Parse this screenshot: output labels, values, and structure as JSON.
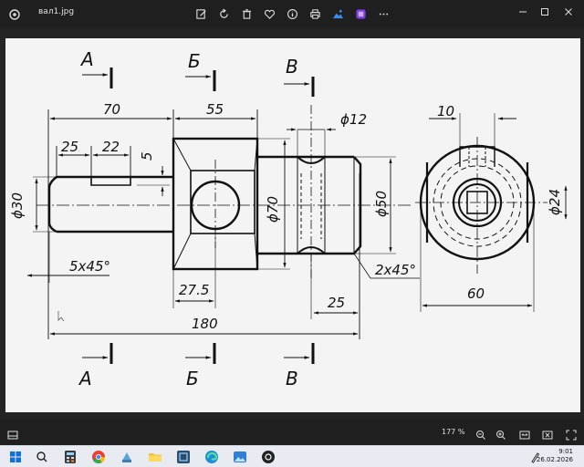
{
  "window": {
    "file_name": "вал1.jpg",
    "toolbar_icons": [
      "edit-icon",
      "rotate-icon",
      "delete-icon",
      "favorite-icon",
      "info-icon",
      "print-icon",
      "edit-photo-icon",
      "clipchamp-icon",
      "more-icon"
    ],
    "window_controls": [
      "minimize-icon",
      "maximize-icon",
      "close-icon"
    ]
  },
  "drawing": {
    "section_letters": {
      "a": "А",
      "b": "Б",
      "v": "В"
    },
    "dims": {
      "d70": "70",
      "d55": "55",
      "d25_top": "25",
      "d22": "22",
      "d5": "5",
      "phi12": "ϕ12",
      "d10": "10",
      "phi30": "ϕ30",
      "phi70": "ϕ70",
      "phi50": "ϕ50",
      "phi24": "ϕ24",
      "chamfer_left": "5x45°",
      "chamfer_right": "2x45°",
      "d27_5": "27.5",
      "d25_bottom": "25",
      "d60": "60",
      "d180": "180"
    }
  },
  "status": {
    "zoom": "177 %"
  },
  "taskbar": {
    "time": "9:01",
    "date": "26.02.2026"
  }
}
